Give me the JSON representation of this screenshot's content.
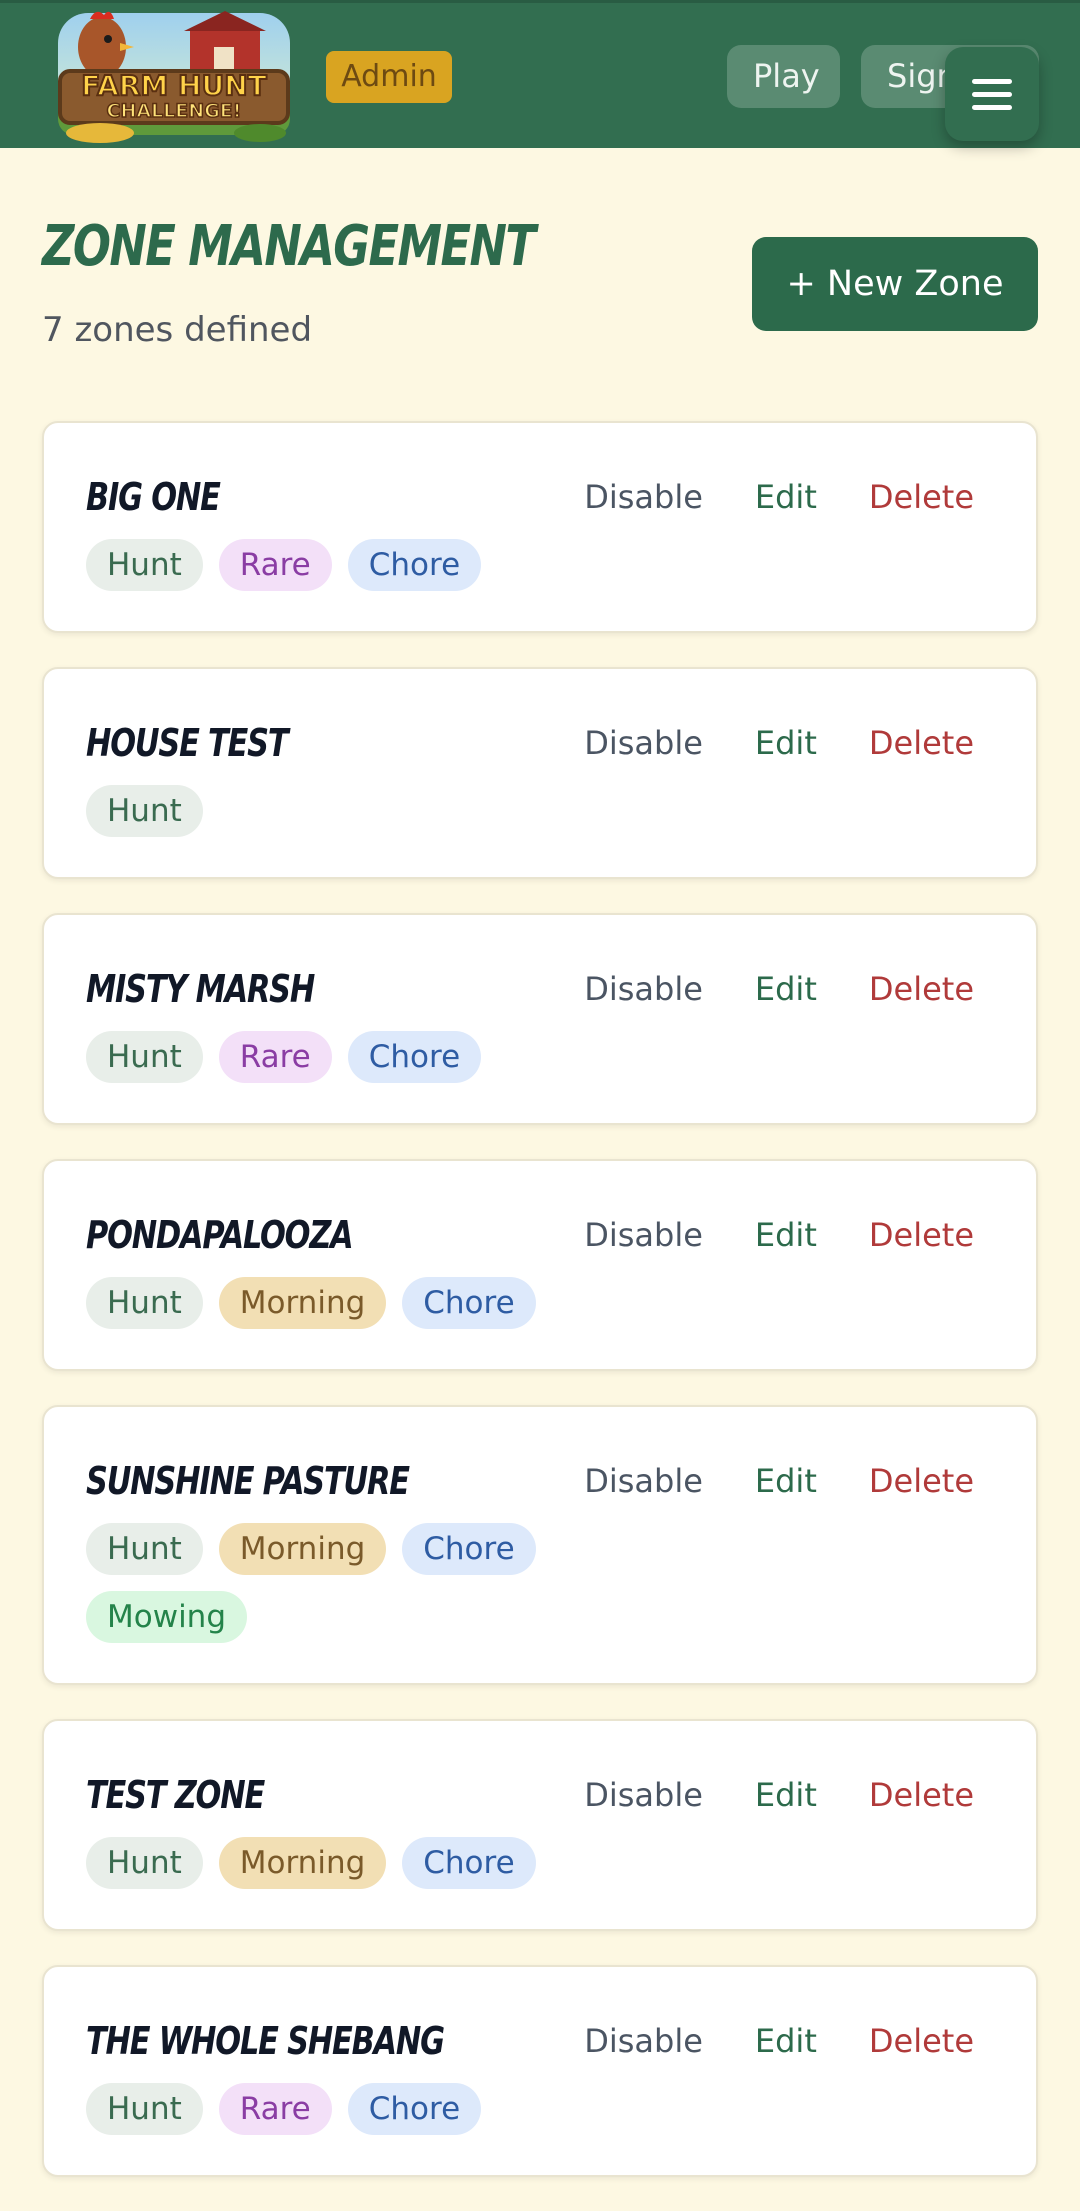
{
  "header": {
    "logo_text_line1": "FARM HUNT",
    "logo_text_line2": "CHALLENGE!",
    "admin_badge": "Admin",
    "nav": {
      "play": "Play",
      "sign": "Sign"
    },
    "menu_icon": "hamburger-menu-icon"
  },
  "page": {
    "title": "ZONE MANAGEMENT",
    "subtitle": "7 zones defined",
    "new_zone_label": "+ New Zone"
  },
  "actions": {
    "disable": "Disable",
    "edit": "Edit",
    "delete": "Delete"
  },
  "tag_styles": {
    "Hunt": {
      "bg": "#e8eee9",
      "fg": "#3a6b50"
    },
    "Rare": {
      "bg": "#f3e0f8",
      "fg": "#8a3da4"
    },
    "Chore": {
      "bg": "#dde9fb",
      "fg": "#2e5ca3"
    },
    "Morning": {
      "bg": "#f2dfb4",
      "fg": "#7a5a2a"
    },
    "Mowing": {
      "bg": "#d9f7e0",
      "fg": "#24834a"
    }
  },
  "zones": [
    {
      "name": "BIG ONE",
      "tags": [
        "Hunt",
        "Rare",
        "Chore"
      ]
    },
    {
      "name": "HOUSE TEST",
      "tags": [
        "Hunt"
      ]
    },
    {
      "name": "MISTY MARSH",
      "tags": [
        "Hunt",
        "Rare",
        "Chore"
      ]
    },
    {
      "name": "PONDAPALOOZA",
      "tags": [
        "Hunt",
        "Morning",
        "Chore"
      ]
    },
    {
      "name": "SUNSHINE PASTURE",
      "tags": [
        "Hunt",
        "Morning",
        "Chore",
        "Mowing"
      ]
    },
    {
      "name": "TEST ZONE",
      "tags": [
        "Hunt",
        "Morning",
        "Chore"
      ]
    },
    {
      "name": "THE WHOLE SHEBANG",
      "tags": [
        "Hunt",
        "Rare",
        "Chore"
      ]
    }
  ]
}
